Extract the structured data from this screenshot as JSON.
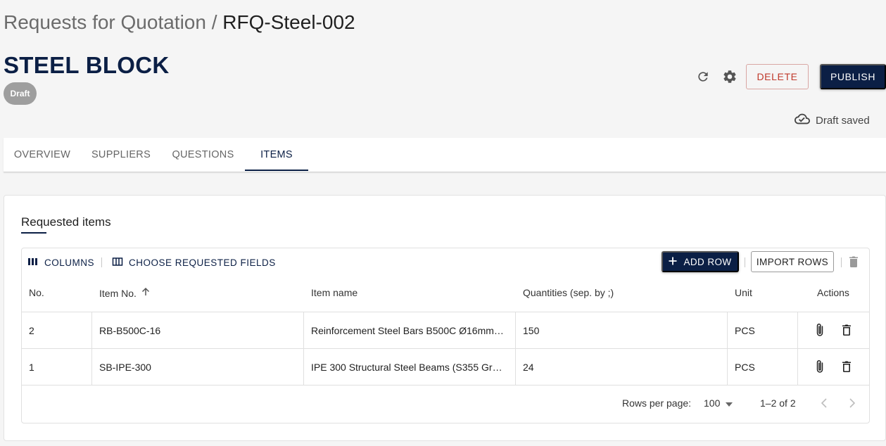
{
  "breadcrumb": {
    "parent": "Requests for Quotation",
    "separator": " / ",
    "current": "RFQ-Steel-002"
  },
  "title": "STEEL BLOCK",
  "status_badge": "Draft",
  "actions": {
    "delete_label": "DELETE",
    "publish_label": "PUBLISH"
  },
  "draft_status": "Draft saved",
  "tabs": [
    {
      "label": "OVERVIEW"
    },
    {
      "label": "SUPPLIERS"
    },
    {
      "label": "QUESTIONS"
    },
    {
      "label": "ITEMS"
    }
  ],
  "active_tab": "ITEMS",
  "card": {
    "title": "Requested items",
    "toolbar": {
      "columns_label": "COLUMNS",
      "choose_fields_label": "CHOOSE REQUESTED FIELDS",
      "add_row_label": "ADD ROW",
      "import_rows_label": "IMPORT ROWS"
    },
    "columns": [
      "No.",
      "Item No.",
      "Item name",
      "Quantities (sep. by ;)",
      "Unit",
      "Actions"
    ],
    "sort": {
      "column": "Item No.",
      "direction": "ascending"
    },
    "rows": [
      {
        "no": "2",
        "item_no": "RB-B500C-16",
        "item_name": "Reinforcement Steel Bars B500C Ø16mm…",
        "quantities": "150",
        "unit": "PCS"
      },
      {
        "no": "1",
        "item_no": "SB-IPE-300",
        "item_name": "IPE 300 Structural Steel Beams (S355 Gr…",
        "quantities": "24",
        "unit": "PCS"
      }
    ],
    "pagination": {
      "rows_per_page_label": "Rows per page:",
      "rows_per_page": "100",
      "range": "1–2 of 2"
    }
  },
  "colors": {
    "primary": "#0b1f45",
    "danger": "#c0392b",
    "badge": "#9e9e9e"
  }
}
